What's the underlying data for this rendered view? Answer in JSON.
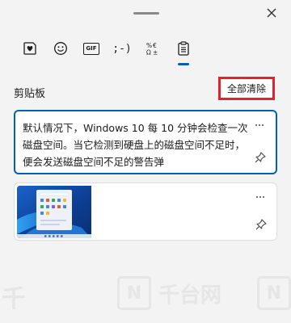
{
  "window": {
    "grip_icon": "drag-handle",
    "close_icon": "close-x"
  },
  "tabs": [
    {
      "id": "stickers",
      "icon": "heart-sticker-icon"
    },
    {
      "id": "emoji",
      "icon": "smiley-icon"
    },
    {
      "id": "gif",
      "label": "GIF",
      "icon": "gif-icon"
    },
    {
      "id": "kaomoji",
      "label": ";-)",
      "icon": "kaomoji-icon"
    },
    {
      "id": "symbols",
      "icon": "symbols-icon"
    },
    {
      "id": "clipboard",
      "icon": "clipboard-icon",
      "active": true
    }
  ],
  "clipboard": {
    "title": "剪贴板",
    "clear_all_label": "全部清除",
    "items": [
      {
        "type": "text",
        "text": "默认情况下，Windows 10 每 10 分钟会检查一次磁盘空间。当它检测到硬盘上的磁盘空间不足时，便会发送磁盘空间不足的警告弹",
        "more_icon": "more-dots-icon",
        "pin_icon": "pin-icon"
      },
      {
        "type": "image",
        "more_icon": "more-dots-icon",
        "pin_icon": "pin-icon"
      }
    ]
  },
  "watermark": {
    "left_text": "千",
    "right_text": "千台网",
    "box_letter": "N"
  },
  "colors": {
    "accent": "#005fb8",
    "highlight_box": "#e8202b",
    "panel_bg": "#f3f3f3"
  }
}
